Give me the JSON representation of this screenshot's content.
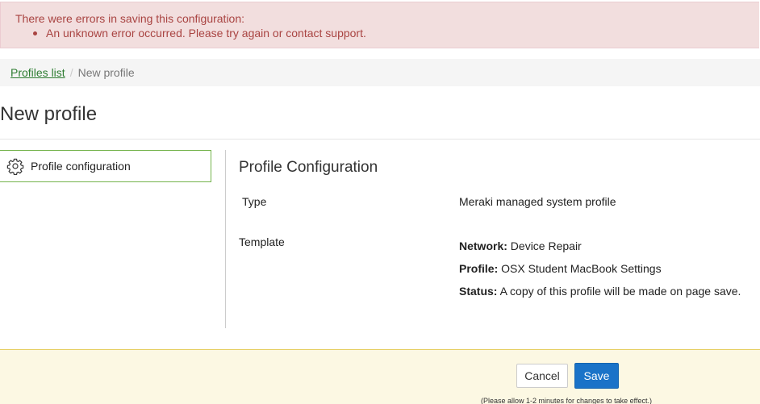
{
  "alert": {
    "title": "There were errors in saving this configuration:",
    "items": [
      "An unknown error occurred. Please try again or contact support."
    ]
  },
  "breadcrumb": {
    "parent": "Profiles list",
    "separator": "/",
    "current": "New profile"
  },
  "page": {
    "title": "New profile"
  },
  "sidebar": {
    "items": [
      {
        "label": "Profile configuration",
        "icon": "gear-icon",
        "active": true
      }
    ]
  },
  "main": {
    "section_title": "Profile Configuration",
    "type": {
      "label": "Type",
      "value": "Meraki managed system profile"
    },
    "template": {
      "label": "Template",
      "network_key": "Network:",
      "network_value": "Device Repair",
      "profile_key": "Profile:",
      "profile_value": "OSX Student MacBook Settings",
      "status_key": "Status:",
      "status_value": "A copy of this profile will be made on page save."
    }
  },
  "footer": {
    "cancel_label": "Cancel",
    "save_label": "Save",
    "note": "(Please allow 1-2 minutes for changes to take effect.)"
  },
  "colors": {
    "error_bg": "#f2dede",
    "error_text": "#a94442",
    "link": "#2e7d32",
    "active_border": "#74b34b",
    "primary": "#1a73c8",
    "footer_bg": "#fcf8e3"
  }
}
